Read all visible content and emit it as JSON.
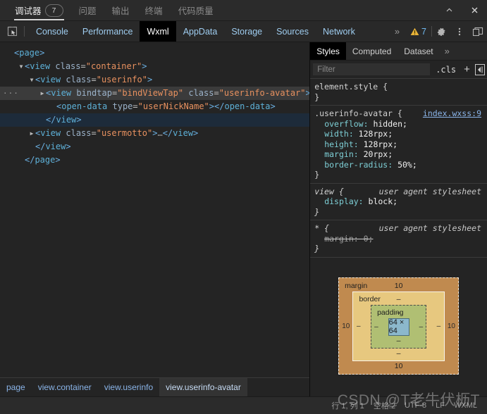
{
  "window": {
    "tabs": [
      {
        "label": "调试器",
        "badge": "7",
        "active": true
      },
      {
        "label": "问题",
        "badge": "",
        "active": false
      },
      {
        "label": "输出",
        "badge": "",
        "active": false
      },
      {
        "label": "终端",
        "badge": "",
        "active": false
      },
      {
        "label": "代码质量",
        "badge": "",
        "active": false
      }
    ],
    "minimize_title": "收起",
    "close_title": "关闭"
  },
  "devtools": {
    "inspect_icon": "inspect-cursor-icon",
    "tabs": [
      {
        "label": "Console",
        "active": false
      },
      {
        "label": "Performance",
        "active": false
      },
      {
        "label": "Wxml",
        "active": true
      },
      {
        "label": "AppData",
        "active": false
      },
      {
        "label": "Storage",
        "active": false
      },
      {
        "label": "Sources",
        "active": false
      },
      {
        "label": "Network",
        "active": false
      }
    ],
    "overflow": "»",
    "warning_count": "7",
    "settings_icon": "gear-icon",
    "kebab_icon": "more-vertical-icon",
    "dock_icon": "dock-panel-icon"
  },
  "tree": {
    "nodes": [
      {
        "indent": 0,
        "arrow": "",
        "state": "",
        "parts": [
          {
            "t": "tagp",
            "s": "<"
          },
          {
            "t": "tag",
            "s": "page"
          },
          {
            "t": "tagp",
            "s": ">"
          }
        ]
      },
      {
        "indent": 1,
        "arrow": "▼",
        "state": "",
        "parts": [
          {
            "t": "tagp",
            "s": "<"
          },
          {
            "t": "tag",
            "s": "view"
          },
          {
            "t": "plain",
            "s": " "
          },
          {
            "t": "attr",
            "s": "class"
          },
          {
            "t": "plain",
            "s": "="
          },
          {
            "t": "val",
            "s": "\"container\""
          },
          {
            "t": "tagp",
            "s": ">"
          }
        ]
      },
      {
        "indent": 2,
        "arrow": "▼",
        "state": "",
        "parts": [
          {
            "t": "tagp",
            "s": "<"
          },
          {
            "t": "tag",
            "s": "view"
          },
          {
            "t": "plain",
            "s": " "
          },
          {
            "t": "attr",
            "s": "class"
          },
          {
            "t": "plain",
            "s": "="
          },
          {
            "t": "val",
            "s": "\"userinfo\""
          },
          {
            "t": "tagp",
            "s": ">"
          }
        ]
      },
      {
        "indent": 3,
        "arrow": "▶",
        "state": "hovered",
        "dots": "···",
        "parts": [
          {
            "t": "tagp",
            "s": "<"
          },
          {
            "t": "tag",
            "s": "view"
          },
          {
            "t": "plain",
            "s": " "
          },
          {
            "t": "attr",
            "s": "bindtap"
          },
          {
            "t": "plain",
            "s": "="
          },
          {
            "t": "val",
            "s": "\"bindViewTap\""
          },
          {
            "t": "plain",
            "s": " "
          },
          {
            "t": "attr",
            "s": "class"
          },
          {
            "t": "plain",
            "s": "="
          },
          {
            "t": "val",
            "s": "\"userinfo-avatar\""
          },
          {
            "t": "tagp",
            "s": ">"
          },
          {
            "t": "ell",
            "s": "…"
          },
          {
            "t": "tagp",
            "s": "</"
          },
          {
            "t": "tag",
            "s": "view"
          },
          {
            "t": "tagp",
            "s": ">"
          }
        ]
      },
      {
        "indent": 4,
        "arrow": "",
        "state": "",
        "parts": [
          {
            "t": "tagp",
            "s": "<"
          },
          {
            "t": "tag",
            "s": "open-data"
          },
          {
            "t": "plain",
            "s": " "
          },
          {
            "t": "attr",
            "s": "type"
          },
          {
            "t": "plain",
            "s": "="
          },
          {
            "t": "val",
            "s": "\"userNickName\""
          },
          {
            "t": "tagp",
            "s": ">"
          },
          {
            "t": "tagp",
            "s": "</"
          },
          {
            "t": "tag",
            "s": "open-data"
          },
          {
            "t": "tagp",
            "s": ">"
          }
        ]
      },
      {
        "indent": 3,
        "arrow": "",
        "state": "selected",
        "parts": [
          {
            "t": "tagp",
            "s": "</"
          },
          {
            "t": "tag",
            "s": "view"
          },
          {
            "t": "tagp",
            "s": ">"
          }
        ]
      },
      {
        "indent": 2,
        "arrow": "▶",
        "state": "",
        "parts": [
          {
            "t": "tagp",
            "s": "<"
          },
          {
            "t": "tag",
            "s": "view"
          },
          {
            "t": "plain",
            "s": " "
          },
          {
            "t": "attr",
            "s": "class"
          },
          {
            "t": "plain",
            "s": "="
          },
          {
            "t": "val",
            "s": "\"usermotto\""
          },
          {
            "t": "tagp",
            "s": ">"
          },
          {
            "t": "ell",
            "s": "…"
          },
          {
            "t": "tagp",
            "s": "</"
          },
          {
            "t": "tag",
            "s": "view"
          },
          {
            "t": "tagp",
            "s": ">"
          }
        ]
      },
      {
        "indent": 2,
        "arrow": "",
        "state": "",
        "parts": [
          {
            "t": "tagp",
            "s": "</"
          },
          {
            "t": "tag",
            "s": "view"
          },
          {
            "t": "tagp",
            "s": ">"
          }
        ]
      },
      {
        "indent": 1,
        "arrow": "",
        "state": "",
        "parts": [
          {
            "t": "tagp",
            "s": "</"
          },
          {
            "t": "tag",
            "s": "page"
          },
          {
            "t": "tagp",
            "s": ">"
          }
        ]
      }
    ]
  },
  "breadcrumb": {
    "items": [
      {
        "label": "page",
        "active": false
      },
      {
        "label": "view.container",
        "active": false
      },
      {
        "label": "view.userinfo",
        "active": false
      },
      {
        "label": "view.userinfo-avatar",
        "active": true
      }
    ]
  },
  "styles": {
    "tabs": [
      {
        "label": "Styles",
        "active": true
      },
      {
        "label": "Computed",
        "active": false
      },
      {
        "label": "Dataset",
        "active": false
      }
    ],
    "overflow": "»",
    "filter_placeholder": "Filter",
    "filter_value": "",
    "cls_label": ".cls",
    "plus_label": "+",
    "panel_toggle_icon": "sidebar-toggle-icon",
    "rules": [
      {
        "selector": "element.style {",
        "origin": "",
        "ua": "",
        "declarations": [],
        "close": "}"
      },
      {
        "selector": ".userinfo-avatar {",
        "origin": "index.wxss:9",
        "ua": "",
        "declarations": [
          {
            "prop": "overflow",
            "value": "hidden;",
            "struck": false
          },
          {
            "prop": "width",
            "value": "128rpx;",
            "struck": false
          },
          {
            "prop": "height",
            "value": "128rpx;",
            "struck": false
          },
          {
            "prop": "margin",
            "value": "20rpx;",
            "struck": false
          },
          {
            "prop": "border-radius",
            "value": "50%;",
            "struck": false
          }
        ],
        "close": "}"
      },
      {
        "selector": "view {",
        "origin": "",
        "ua": "user agent stylesheet",
        "declarations": [
          {
            "prop": "display",
            "value": "block;",
            "struck": false
          }
        ],
        "close": "}"
      },
      {
        "selector": "* {",
        "origin": "",
        "ua": "user agent stylesheet",
        "declarations": [
          {
            "prop": "margin",
            "value": "0;",
            "struck": true
          }
        ],
        "close": "}"
      }
    ]
  },
  "box_model": {
    "margin_label": "margin",
    "border_label": "border",
    "padding_label": "padding",
    "content_size": "64 × 64",
    "margin_top": "10",
    "margin_right": "10",
    "margin_bottom": "10",
    "margin_left": "10",
    "border_top": "–",
    "border_right": "–",
    "border_bottom": "–",
    "border_left": "–",
    "padding_top": "–",
    "padding_right": "–",
    "padding_bottom": "–",
    "padding_left": "–",
    "colors": {
      "margin": "#c08a4f",
      "border": "#e7c87f",
      "padding": "#b0bf73",
      "content": "#8cb8cc"
    }
  },
  "statusbar": {
    "position": "行 1, 列 1",
    "indent": "空格:2",
    "encoding": "UTF-8",
    "eol": "LF",
    "language": "WXML"
  },
  "watermark": {
    "text": "CSDN @T老牛伏枥T"
  }
}
